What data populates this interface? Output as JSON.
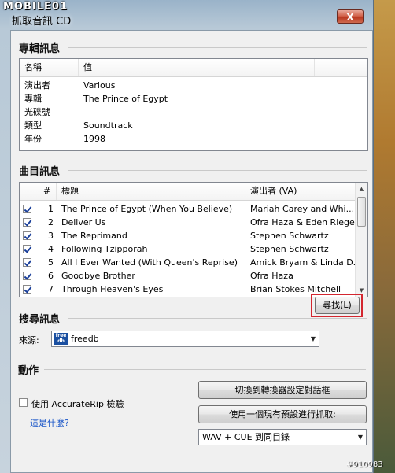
{
  "watermark_logo": "MOBILE01",
  "window": {
    "title": "抓取音訊 CD",
    "close_label": "X"
  },
  "album": {
    "heading": "專輯訊息",
    "columns": [
      "名稱",
      "值"
    ],
    "rows": [
      {
        "name": "演出者",
        "value": "Various"
      },
      {
        "name": "專輯",
        "value": "The Prince of Egypt"
      },
      {
        "name": "光碟號",
        "value": ""
      },
      {
        "name": "類型",
        "value": "Soundtrack"
      },
      {
        "name": "年份",
        "value": "1998"
      }
    ]
  },
  "tracks": {
    "heading": "曲目訊息",
    "columns": [
      "#",
      "標題",
      "演出者 (VA)"
    ],
    "rows": [
      {
        "checked": true,
        "num": "1",
        "title": "The Prince of Egypt (When You Believe)",
        "artist": "Mariah Carey and Whi..."
      },
      {
        "checked": true,
        "num": "2",
        "title": "Deliver Us",
        "artist": "Ofra Haza & Eden Riegel"
      },
      {
        "checked": true,
        "num": "3",
        "title": "The Reprimand",
        "artist": "Stephen Schwartz"
      },
      {
        "checked": true,
        "num": "4",
        "title": "Following Tzipporah",
        "artist": "Stephen Schwartz"
      },
      {
        "checked": true,
        "num": "5",
        "title": "All I Ever Wanted (With Queen's Reprise)",
        "artist": "Amick Bryam & Linda D..."
      },
      {
        "checked": true,
        "num": "6",
        "title": "Goodbye Brother",
        "artist": "Ofra Haza"
      },
      {
        "checked": true,
        "num": "7",
        "title": "Through Heaven's Eyes",
        "artist": "Brian Stokes Mitchell"
      }
    ]
  },
  "search": {
    "heading": "搜尋訊息",
    "source_label": "來源:",
    "source_logo": "free db",
    "source_value": "freedb",
    "find_button": "尋找(L)"
  },
  "actions": {
    "heading": "動作",
    "accuraterip_label": "使用 AccurateRip 檢驗",
    "accuraterip_checked": false,
    "help_link": "這是什麼?",
    "switch_button": "切換到轉換器設定對話框",
    "rip_button": "使用一個現有預設進行抓取:",
    "preset_value": "WAV + CUE 到同目錄"
  },
  "watermark_id": "#910983",
  "colors": {
    "highlight_box": "#d3262f",
    "link": "#1a56c8"
  }
}
